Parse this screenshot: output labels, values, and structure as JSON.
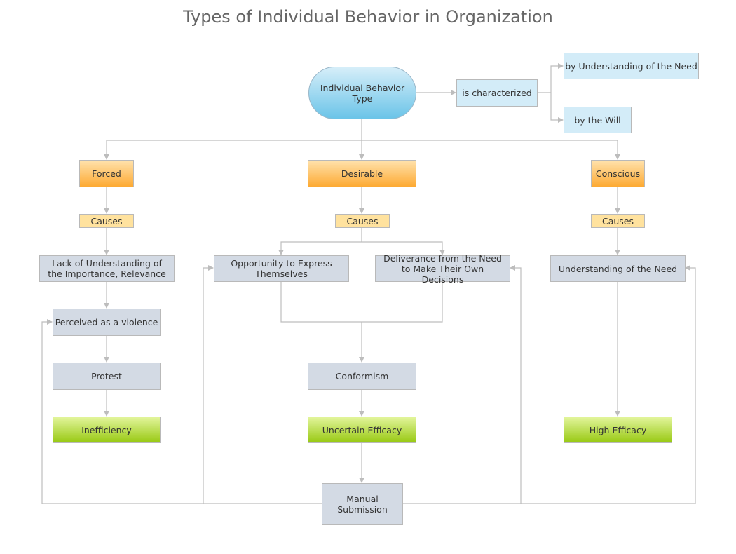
{
  "title": "Types of Individual Behavior in Organization",
  "nodes": {
    "root": "Individual Behavior Type",
    "characterized": "is characterized",
    "by_understanding": "by Understanding of the Need",
    "by_will": "by the Will",
    "forced": "Forced",
    "desirable": "Desirable",
    "conscious": "Conscious",
    "causes_forced": "Causes",
    "causes_desirable": "Causes",
    "causes_conscious": "Causes",
    "lack_understanding": "Lack of Understanding of the Importance, Relevance",
    "perceived_violence": "Perceived as a violence",
    "protest": "Protest",
    "inefficiency": "Inefficiency",
    "opportunity_express": "Opportunity to Express Themselves",
    "deliverance": "Deliverance from the Need to Make Their Own Decisions",
    "conformism": "Conformism",
    "uncertain_efficacy": "Uncertain Efficacy",
    "manual_submission": "Manual Submission",
    "understanding_need": "Understanding of the Need",
    "high_efficacy": "High Efficacy"
  },
  "connector_color": "#bdbdbd"
}
